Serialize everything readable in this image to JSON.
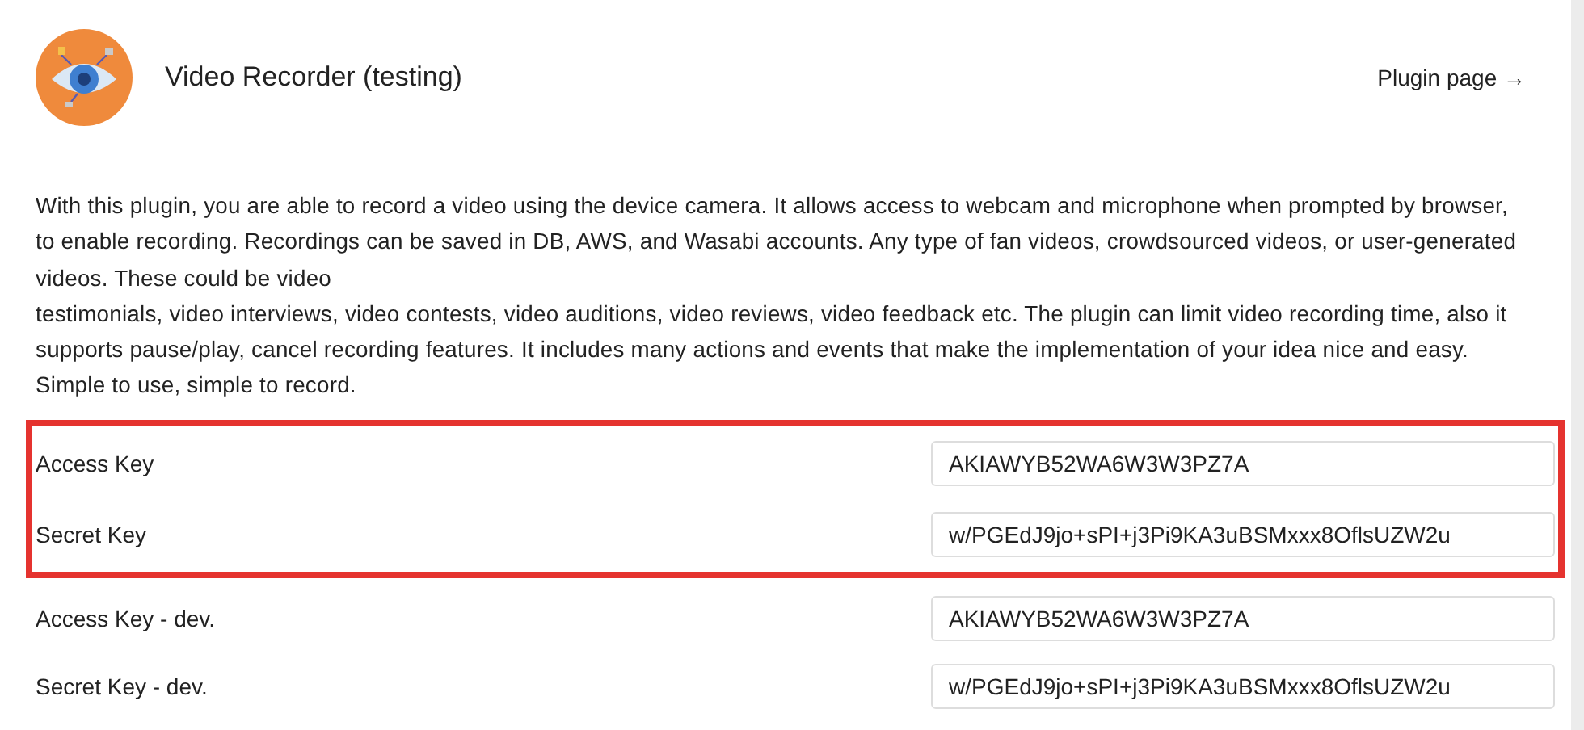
{
  "header": {
    "title": "Video Recorder (testing)",
    "link": "Plugin page →"
  },
  "description": [
    "With this plugin, you are able to record a video using the device camera. It allows access to webcam and microphone when prompted by browser, to enable recording. Recordings can be saved in DB, AWS, and Wasabi accounts. Any type of fan videos, crowdsourced videos, or user-generated videos. These could be video",
    "testimonials, video interviews, video contests, video auditions, video reviews, video feedback etc. The plugin can limit video recording time, also it supports pause/play, cancel recording features. It includes many actions and events that make the implementation of your idea nice and easy. Simple to use, simple to record."
  ],
  "fields": [
    {
      "label": "Access Key",
      "value": "AKIAWYB52WA6W3W3PZ7A",
      "highlighted": true
    },
    {
      "label": "Secret Key",
      "value": "w/PGEdJ9jo+sPI+j3Pi9KA3uBSMxxx8OflsUZW2u",
      "highlighted": true
    },
    {
      "label": "Access Key - dev.",
      "value": "AKIAWYB52WA6W3W3PZ7A",
      "highlighted": false
    },
    {
      "label": "Secret Key - dev.",
      "value": "w/PGEdJ9jo+sPI+j3Pi9KA3uBSMxxx8OflsUZW2u",
      "highlighted": false
    }
  ]
}
